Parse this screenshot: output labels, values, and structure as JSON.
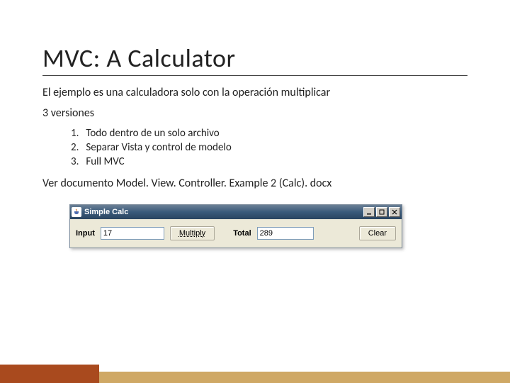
{
  "title": "MVC:  A Calculator",
  "line1": "El ejemplo es una calculadora solo con la operación multiplicar",
  "line2": "3 versiones",
  "list": {
    "n1": "1.",
    "i1": "Todo dentro de un solo archivo",
    "n2": "2.",
    "i2": "Separar Vista y control de modelo",
    "n3": "3.",
    "i3": "Full MVC"
  },
  "docline": "Ver documento Model. View. Controller. Example 2 (Calc). docx",
  "window": {
    "title": "Simple Calc",
    "input_label": "Input",
    "input_value": "17",
    "multiply": "Multiply",
    "total_label": "Total",
    "total_value": "289",
    "clear": "Clear"
  }
}
